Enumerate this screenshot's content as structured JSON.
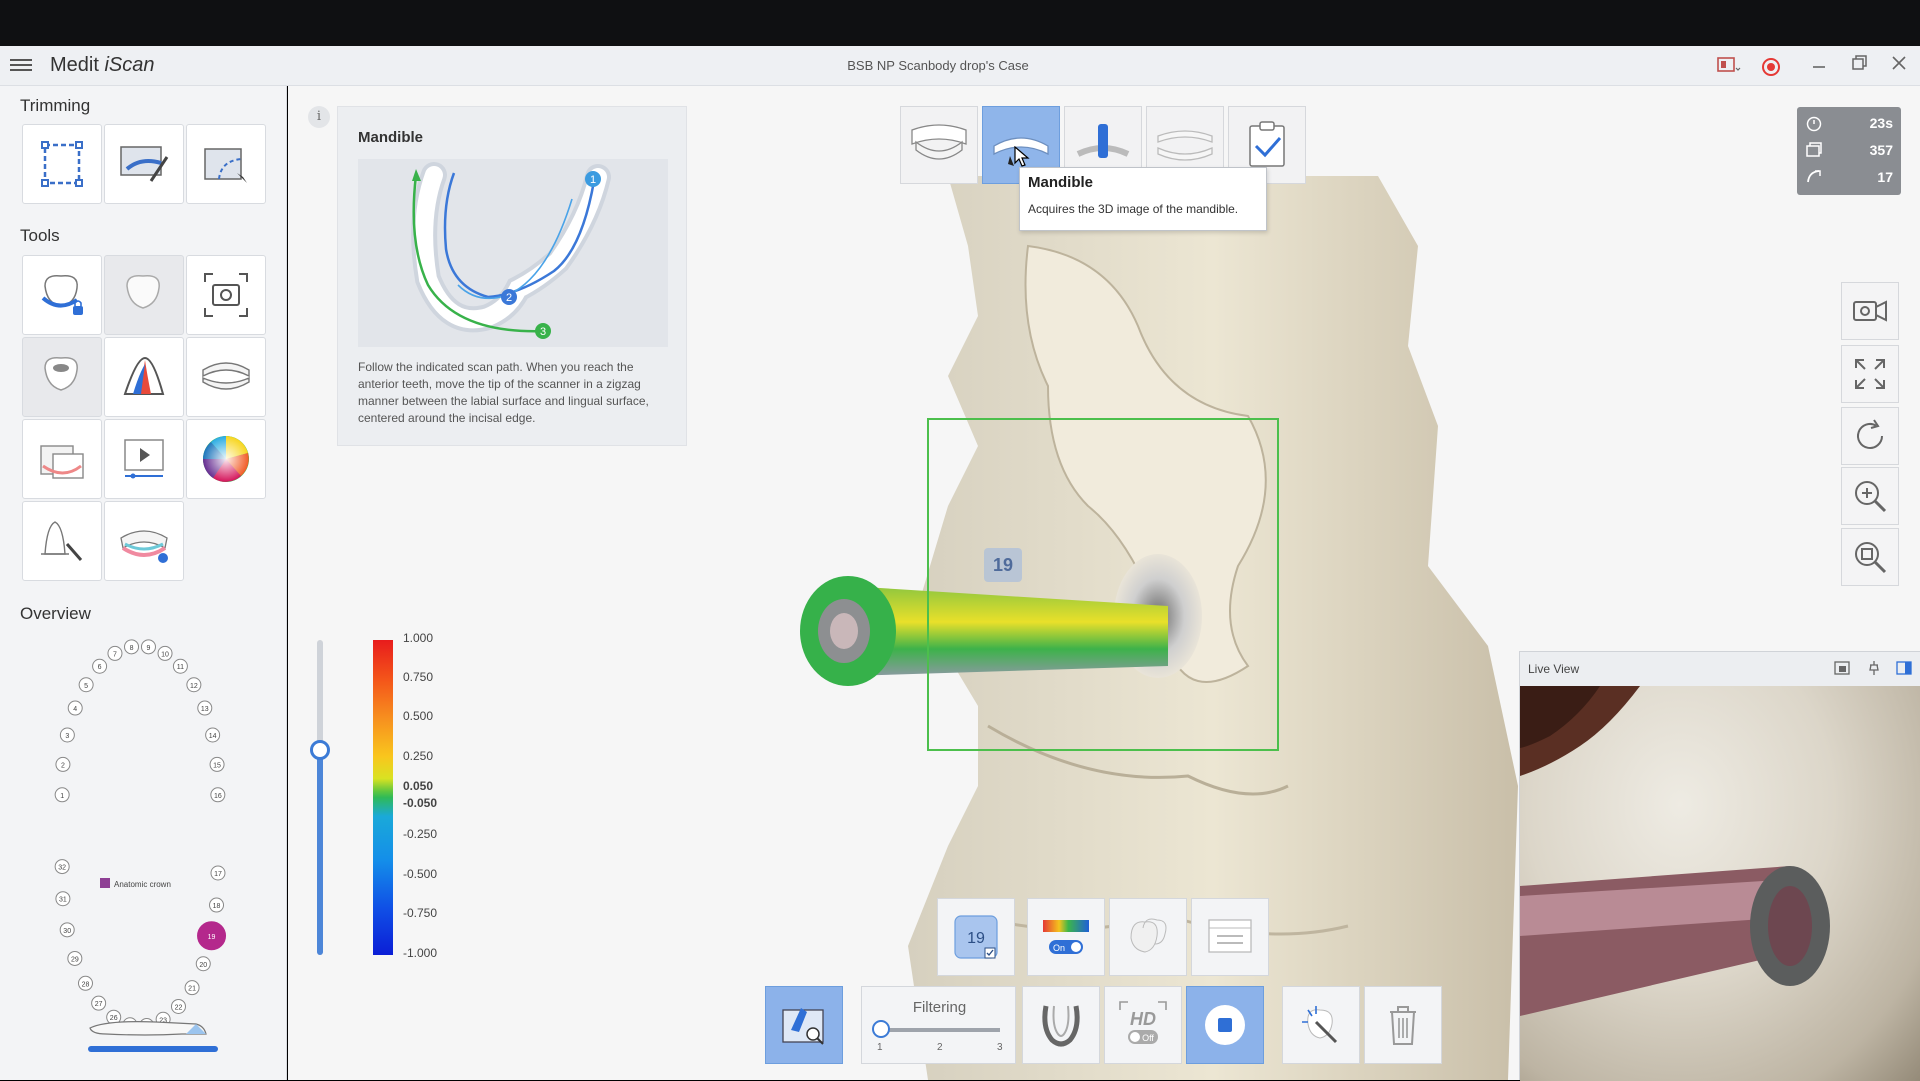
{
  "app": {
    "title_prefix": "Medit",
    "title_suffix": "iScan",
    "case_title": "BSB NP Scanbody drop's Case"
  },
  "sidebar": {
    "trimming_title": "Trimming",
    "tools_title": "Tools",
    "overview_title": "Overview",
    "overview_legend": "Anatomic crown",
    "upper_teeth": [
      "1",
      "2",
      "3",
      "4",
      "5",
      "6",
      "7",
      "8",
      "9",
      "10",
      "11",
      "12",
      "13",
      "14",
      "15",
      "16"
    ],
    "lower_teeth": [
      "17",
      "18",
      "19",
      "20",
      "21",
      "22",
      "23",
      "24",
      "25",
      "26",
      "27",
      "28",
      "29",
      "30",
      "31",
      "32"
    ],
    "selected_tooth": "19"
  },
  "guide": {
    "info": "i",
    "title": "Mandible",
    "text": "Follow the indicated scan path. When you reach the anterior teeth, move the tip of the scanner in a zigzag manner between the labial surface and lingual surface, centered around the incisal edge.",
    "steps": [
      "1",
      "2",
      "3"
    ]
  },
  "colorbar": {
    "labels": [
      "1.000",
      "0.750",
      "0.500",
      "0.250",
      "0.050",
      "-0.050",
      "-0.250",
      "-0.500",
      "-0.750",
      "-1.000"
    ]
  },
  "tooltip": {
    "title": "Mandible",
    "description": "Acquires the 3D image of the mandible."
  },
  "stats": {
    "time": "23s",
    "frames": "357",
    "count": "17"
  },
  "scanbody_label": "19",
  "liveview": {
    "title": "Live View"
  },
  "bottom": {
    "tooth_label": "19",
    "toggle_label": "On",
    "filter_label": "Filtering",
    "filter_ticks": [
      "1",
      "2",
      "3"
    ],
    "hd_label": "HD",
    "hd_toggle": "Off"
  },
  "colors": {
    "accent": "#3c7bd6",
    "active_button": "#8fb5ea",
    "scan_box": "#4cbf4c",
    "record": "#e53935"
  }
}
